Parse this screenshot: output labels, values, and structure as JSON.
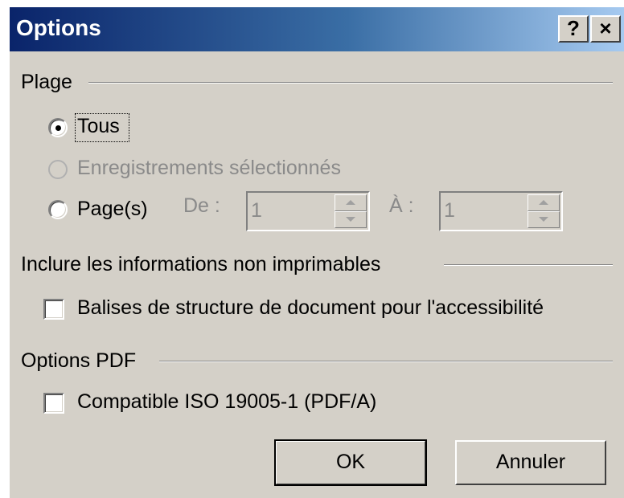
{
  "window": {
    "title": "Options",
    "help_label": "?",
    "close_label": "×"
  },
  "range": {
    "group_label": "Plage",
    "all_label": "Tous",
    "all_selected": true,
    "selected_records_label": "Enregistrements sélectionnés",
    "pages_label": "Page(s)",
    "from_label": "De :",
    "from_value": "1",
    "to_label": "À :",
    "to_value": "1"
  },
  "nonprint": {
    "group_label": "Inclure les informations non imprimables",
    "tags_label": "Balises de structure de document pour l'accessibilité",
    "tags_checked": false
  },
  "pdf": {
    "group_label": "Options PDF",
    "iso_label": "Compatible ISO 19005-1 (PDF/A)",
    "iso_checked": false
  },
  "buttons": {
    "ok_label": "OK",
    "cancel_label": "Annuler"
  }
}
